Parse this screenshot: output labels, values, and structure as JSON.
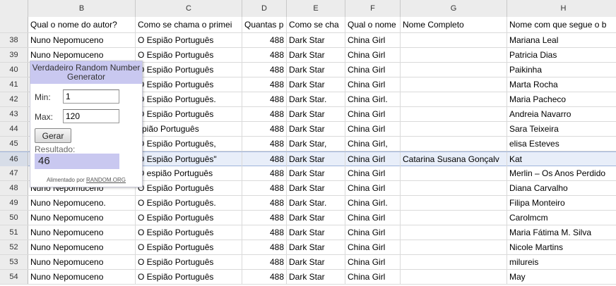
{
  "columns": [
    "B",
    "C",
    "D",
    "E",
    "F",
    "G",
    "H"
  ],
  "headers": [
    "Qual o nome do autor?",
    "Como se chama o primei",
    "Quantas p",
    "Como se cha",
    "Qual o nome",
    "Nome Completo",
    "Nome com que segue o b"
  ],
  "rows": [
    {
      "n": "38",
      "b": "Nuno Nepomuceno",
      "c": "O Espião Português",
      "d": "488",
      "e": "Dark Star",
      "f": "China Girl",
      "g": "",
      "h": "Mariana Leal"
    },
    {
      "n": "39",
      "b": "Nuno Nepomuceno",
      "c": " O Espião Português",
      "d": "488",
      "e": "Dark Star",
      "f": "China Girl",
      "g": "",
      "h": "Patricia Dias"
    },
    {
      "n": "40",
      "b": "",
      "c": "O Espião Português",
      "d": "488",
      "e": "Dark Star",
      "f": "China Girl",
      "g": "",
      "h": "Paikinha"
    },
    {
      "n": "41",
      "b": "",
      "c": "O Espião Português",
      "d": "488",
      "e": "Dark Star",
      "f": "China Girl",
      "g": "",
      "h": "Marta Rocha"
    },
    {
      "n": "42",
      "b": "",
      "c": "O Espião Português.",
      "d": "488",
      "e": "Dark Star.",
      "f": "China Girl.",
      "g": "",
      "h": "Maria Pacheco"
    },
    {
      "n": "43",
      "b": "",
      "c": "O Espião Português",
      "d": "488",
      "e": "Dark Star",
      "f": "China Girl",
      "g": "",
      "h": "Andreia Navarro"
    },
    {
      "n": "44",
      "b": "",
      "c": "spião Português",
      "d": "488",
      "e": "Dark Star",
      "f": "China Girl",
      "g": "",
      "h": "Sara Teixeira"
    },
    {
      "n": "45",
      "b": "",
      "c": "O Espião Português,",
      "d": "488",
      "e": "Dark Star,",
      "f": "China Girl,",
      "g": "",
      "h": "elisa Esteves"
    },
    {
      "n": "46",
      "b": "",
      "c": "O Espião Português\"",
      "d": "488",
      "e": "Dark Star",
      "f": "China Girl",
      "g": "Catarina Susana Gonçalv",
      "h": "Kat"
    },
    {
      "n": "47",
      "b": "",
      "c": "O espião Português",
      "d": "488",
      "e": "Dark Star",
      "f": "China Girl",
      "g": "",
      "h": "Merlin – Os Anos Perdido"
    },
    {
      "n": "48",
      "b": "Nuno Nepomuceno",
      "c": "O Espião Português",
      "d": "488",
      "e": "Dark Star",
      "f": "China Girl",
      "g": "",
      "h": "Diana Carvalho"
    },
    {
      "n": "49",
      "b": "Nuno Nepomuceno.",
      "c": "O Espião Português.",
      "d": "488",
      "e": "Dark Star.",
      "f": "China Girl.",
      "g": "",
      "h": "Filipa Monteiro"
    },
    {
      "n": "50",
      "b": "Nuno Nepomuceno",
      "c": "O Espião Português",
      "d": "488",
      "e": "Dark Star",
      "f": "China Girl",
      "g": "",
      "h": "Carolmcm"
    },
    {
      "n": "51",
      "b": "Nuno Nepomuceno",
      "c": "O Espião Português",
      "d": "488",
      "e": "Dark Star",
      "f": "China Girl",
      "g": "",
      "h": "Maria Fátima M. Silva"
    },
    {
      "n": "52",
      "b": "Nuno Nepomuceno",
      "c": "O Espião Português",
      "d": "488",
      "e": "Dark Star",
      "f": "China Girl",
      "g": "",
      "h": "Nicole Martins"
    },
    {
      "n": "53",
      "b": " Nuno Nepomuceno",
      "c": "O Espião Português",
      "d": "488",
      "e": " Dark Star",
      "f": "China Girl",
      "g": "",
      "h": "milureis"
    },
    {
      "n": "54",
      "b": "Nuno Nepomuceno",
      "c": "O Espião Português",
      "d": "488",
      "e": "Dark Star",
      "f": "China Girl",
      "g": "",
      "h": "May"
    }
  ],
  "selected_row": "46",
  "widget": {
    "title": "Verdadeiro Random Number Generator",
    "min_label": "Min:",
    "min_value": "1",
    "max_label": "Max:",
    "max_value": "120",
    "button_label": "Gerar",
    "result_label": "Resultado:",
    "result_value": "46",
    "footer_prefix": "Alimentado por",
    "footer_link": "RANDOM.ORG",
    "accent_color": "#c9c8f0"
  }
}
